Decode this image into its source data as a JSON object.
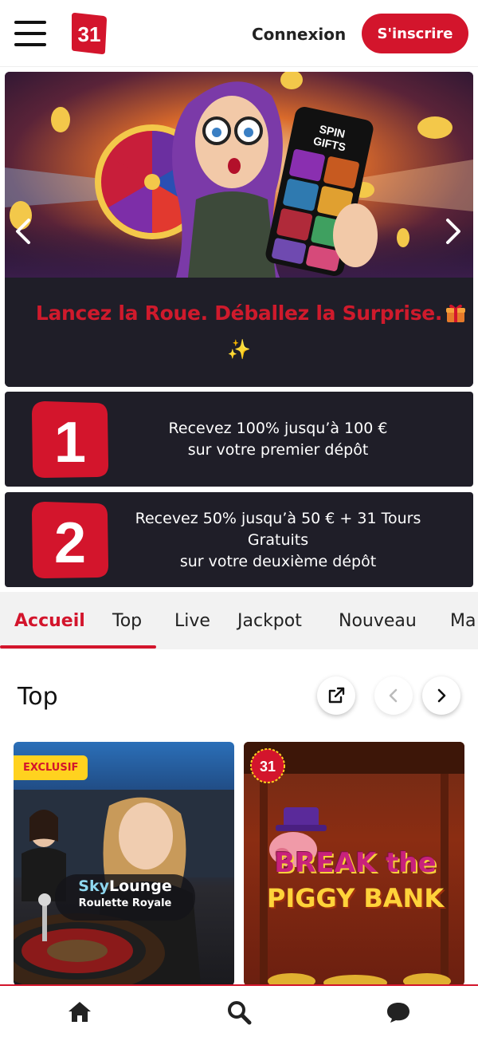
{
  "header": {
    "login_label": "Connexion",
    "signup_label": "S'inscrire",
    "logo_text": "31"
  },
  "banner": {
    "headline": "Lancez la Roue. Déballez la Surprise.",
    "sparkle": "✨",
    "art_text_spin": "SPIN",
    "art_text_gifts": "GIFTS"
  },
  "offers": [
    {
      "number": "1",
      "line1": "Recevez 100% jusqu’à 100 €",
      "line2": "sur votre premier dépôt"
    },
    {
      "number": "2",
      "line1": "Recevez 50% jusqu’à 50 € + 31 Tours Gratuits",
      "line2": "sur votre deuxième dépôt"
    }
  ],
  "tabs": [
    "Accueil",
    "Top",
    "Live",
    "Jackpot",
    "Nouveau",
    "Ma"
  ],
  "section": {
    "title": "Top"
  },
  "games": [
    {
      "badge": "EXCLUSIF",
      "title_part1": "Sky",
      "title_part2": "Lounge",
      "subtitle": "Roulette Royale"
    },
    {
      "badge": "31",
      "title_line1": "BREAK the",
      "title_line2": "PIGGY BANK"
    }
  ],
  "colors": {
    "brand_red": "#d3152c",
    "dark_card": "#1f1e28",
    "gold": "#ffd21f"
  }
}
